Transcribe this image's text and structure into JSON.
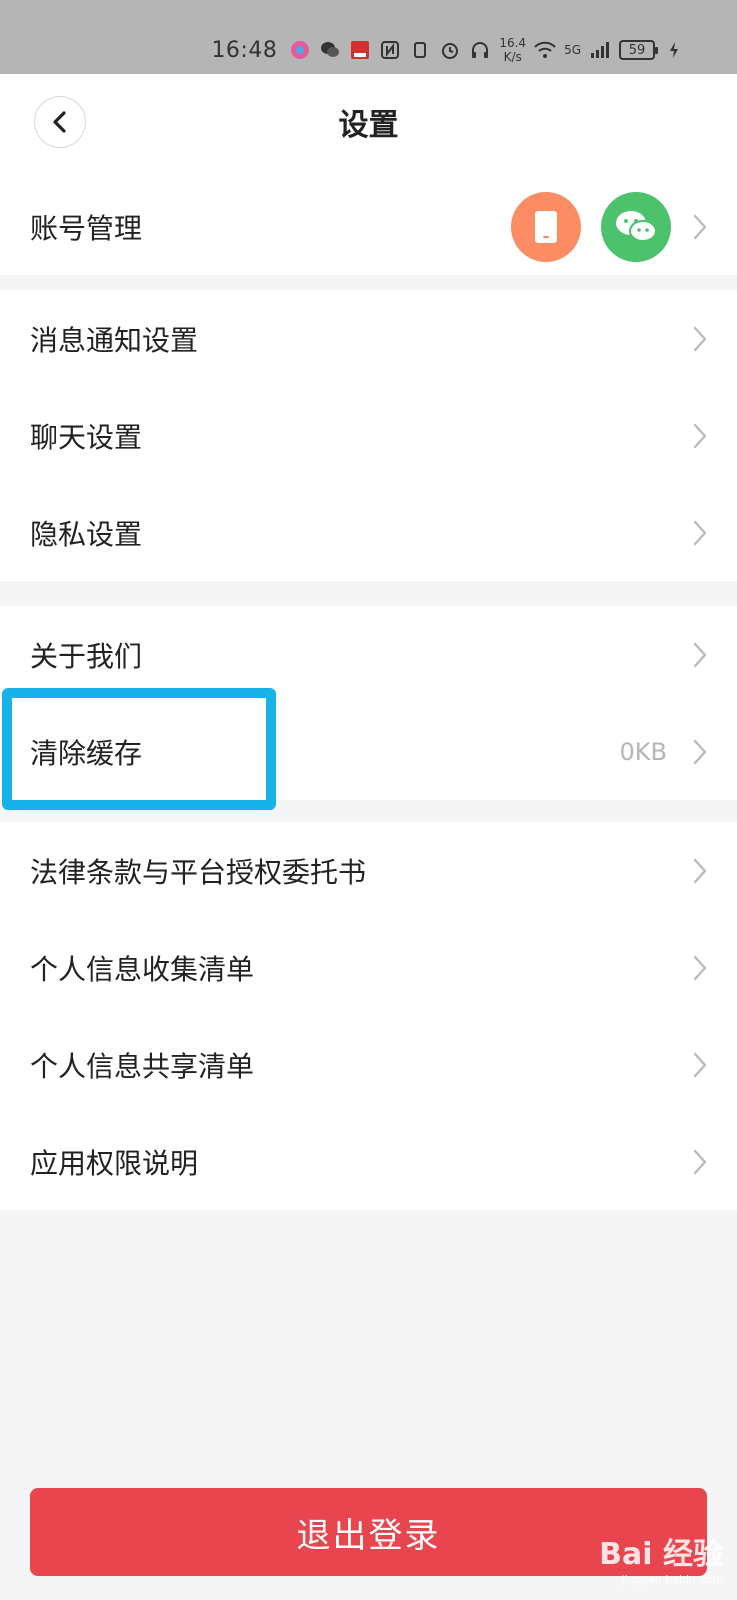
{
  "status_bar": {
    "time": "16:48",
    "speed": "16.4",
    "speed_unit": "K/s",
    "network": "5G",
    "battery": "59"
  },
  "header": {
    "title": "设置"
  },
  "account": {
    "label": "账号管理"
  },
  "group2": [
    {
      "label": "消息通知设置"
    },
    {
      "label": "聊天设置"
    },
    {
      "label": "隐私设置"
    }
  ],
  "group3": [
    {
      "label": "关于我们"
    },
    {
      "label": "清除缓存",
      "value": "0KB"
    }
  ],
  "group4": [
    {
      "label": "法律条款与平台授权委托书"
    },
    {
      "label": "个人信息收集清单"
    },
    {
      "label": "个人信息共享清单"
    },
    {
      "label": "应用权限说明"
    }
  ],
  "logout": {
    "label": "退出登录"
  },
  "watermark": {
    "text": "Bai 经验",
    "url": "jingyan.baidu.com"
  },
  "colors": {
    "highlight": "#17b3e8",
    "phone_icon_bg": "#fb8c64",
    "wechat_icon_bg": "#4cc26d",
    "logout_bg": "#e8454e"
  }
}
